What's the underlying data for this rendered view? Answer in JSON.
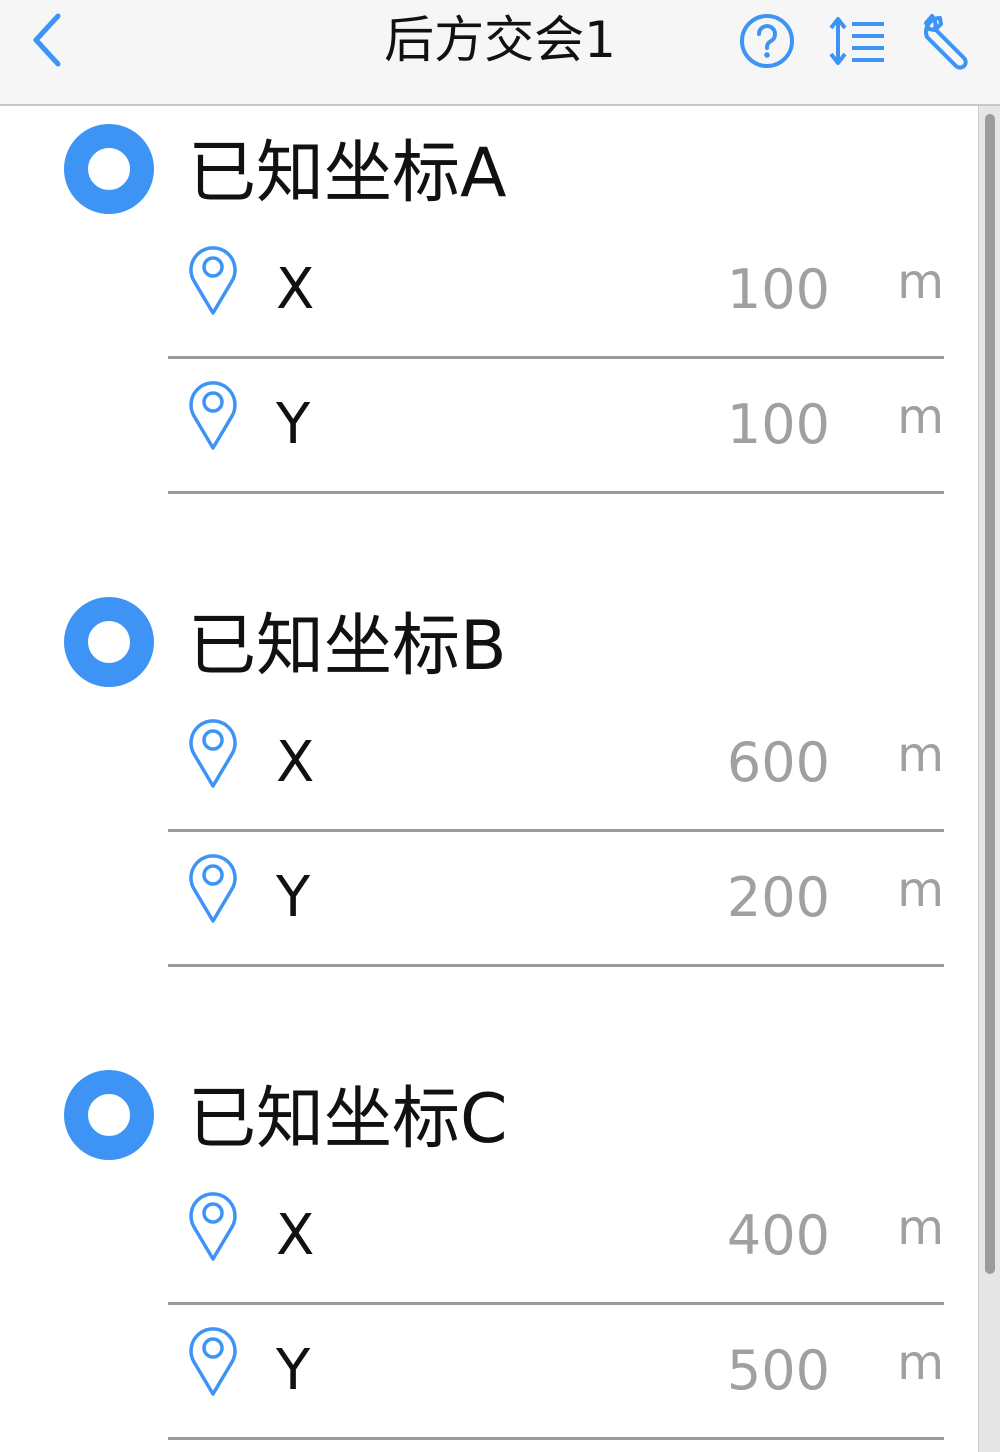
{
  "navbar": {
    "title": "后方交会1",
    "icons": {
      "back": "chevron-left-icon",
      "help": "question-circle-icon",
      "sort": "sort-list-icon",
      "tools": "wrench-icon"
    }
  },
  "colors": {
    "accent": "#3d94f5",
    "value_text": "#a0a0a0",
    "text": "#111111",
    "divider": "#9a9a9a"
  },
  "sections": [
    {
      "title": "已知坐标A",
      "rows": [
        {
          "axis": "X",
          "value": "100",
          "unit": "m",
          "icon": "location-pin-icon"
        },
        {
          "axis": "Y",
          "value": "100",
          "unit": "m",
          "icon": "location-pin-icon"
        }
      ]
    },
    {
      "title": "已知坐标B",
      "rows": [
        {
          "axis": "X",
          "value": "600",
          "unit": "m",
          "icon": "location-pin-icon"
        },
        {
          "axis": "Y",
          "value": "200",
          "unit": "m",
          "icon": "location-pin-icon"
        }
      ]
    },
    {
      "title": "已知坐标C",
      "rows": [
        {
          "axis": "X",
          "value": "400",
          "unit": "m",
          "icon": "location-pin-icon"
        },
        {
          "axis": "Y",
          "value": "500",
          "unit": "m",
          "icon": "location-pin-icon"
        }
      ]
    }
  ]
}
